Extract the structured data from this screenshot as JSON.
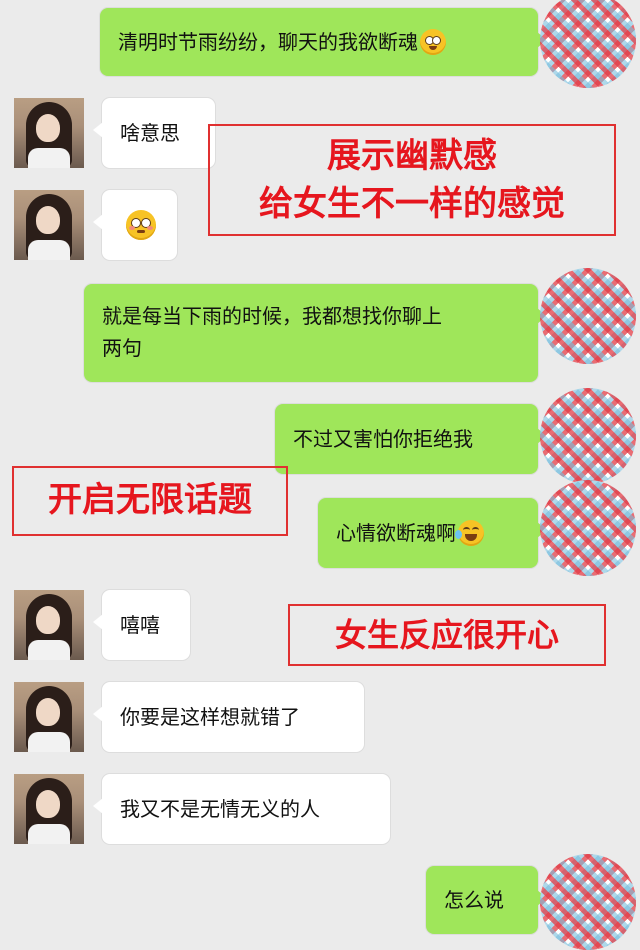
{
  "messages": [
    {
      "id": "m1",
      "from": "me",
      "text": "清明时节雨纷纷，聊天的我欲断魂",
      "emoji": "smiling-sweat-emoji"
    },
    {
      "id": "m2",
      "from": "her",
      "text": "啥意思"
    },
    {
      "id": "m3",
      "from": "her",
      "text": "",
      "emoji": "flushed-emoji"
    },
    {
      "id": "m4",
      "from": "me",
      "line1": "就是每当下雨的时候，我都想找你聊上",
      "line2": "两句"
    },
    {
      "id": "m5",
      "from": "me",
      "text": "不过又害怕你拒绝我"
    },
    {
      "id": "m6",
      "from": "me",
      "text": "心情欲断魂啊",
      "emoji": "laughing-tears-emoji"
    },
    {
      "id": "m7",
      "from": "her",
      "text": "嘻嘻"
    },
    {
      "id": "m8",
      "from": "her",
      "text": "你要是这样想就错了"
    },
    {
      "id": "m9",
      "from": "her",
      "text": "我又不是无情无义的人"
    },
    {
      "id": "m10",
      "from": "me",
      "text": "怎么说"
    }
  ],
  "annotations": {
    "humor": {
      "line1": "展示幽默感",
      "line2": "给女生不一样的感觉"
    },
    "topics": "开启无限话题",
    "happy": "女生反应很开心"
  },
  "colors": {
    "background": "#ebebeb",
    "outgoing_bubble": "#9fe65a",
    "incoming_bubble": "#ffffff",
    "annotation_red": "#e6161e"
  }
}
